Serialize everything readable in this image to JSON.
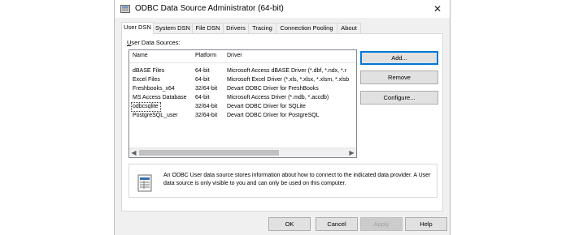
{
  "window": {
    "title": "ODBC Data Source Administrator (64-bit)",
    "close_glyph": "✕"
  },
  "tabs": [
    {
      "label": "User DSN",
      "active": true
    },
    {
      "label": "System DSN",
      "active": false
    },
    {
      "label": "File DSN",
      "active": false
    },
    {
      "label": "Drivers",
      "active": false
    },
    {
      "label": "Tracing",
      "active": false
    },
    {
      "label": "Connection Pooling",
      "active": false
    },
    {
      "label": "About",
      "active": false
    }
  ],
  "panel": {
    "section_label_first": "U",
    "section_label_rest": "ser Data Sources:",
    "columns": [
      "Name",
      "Platform",
      "Driver"
    ],
    "rows": [
      {
        "name": "dBASE Files",
        "platform": "64-bit",
        "driver": "Microsoft Access dBASE Driver (*.dbf, *.ndx, *.r"
      },
      {
        "name": "Excel Files",
        "platform": "64-bit",
        "driver": "Microsoft Excel Driver (*.xls, *.xlsx, *.xlsm, *.xlsb"
      },
      {
        "name": "Freshbooks_x64",
        "platform": "32/64-bit",
        "driver": "Devart ODBC Driver for FreshBooks"
      },
      {
        "name": "MS Access Database",
        "platform": "64-bit",
        "driver": "Microsoft Access Driver (*.mdb, *.accdb)"
      },
      {
        "name": "odbcsqlite",
        "platform": "32/64-bit",
        "driver": "Devart ODBC Driver for SQLite",
        "selected": true
      },
      {
        "name": "PostgreSQL_user",
        "platform": "32/64-bit",
        "driver": "Devart ODBC Driver for PostgreSQL"
      }
    ],
    "buttons": {
      "add": "Add...",
      "remove": "Remove",
      "configure": "Configure..."
    },
    "info_text": "An ODBC User data source stores information about how to connect to the indicated data provider.   A User data source is only visible to you and can only be used on this computer."
  },
  "footer": {
    "ok": "OK",
    "cancel": "Cancel",
    "apply": "Apply",
    "help": "Help"
  },
  "icons": {
    "app": "odbc-admin-icon",
    "info": "datasource-info-icon",
    "scroll_left": "◀",
    "scroll_right": "▶"
  }
}
